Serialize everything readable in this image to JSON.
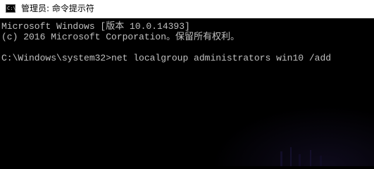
{
  "window": {
    "title": "管理员: 命令提示符",
    "icon_label": "C:\\",
    "icon": "terminal-icon"
  },
  "console": {
    "lines": [
      "Microsoft Windows [版本 10.0.14393]",
      "(c) 2016 Microsoft Corporation。保留所有权利。",
      "",
      "C:\\Windows\\system32>net localgroup administrators win10 /add"
    ]
  },
  "colors": {
    "background": "#000000",
    "text": "#c0c0c0",
    "titlebar": "#ffffff"
  }
}
